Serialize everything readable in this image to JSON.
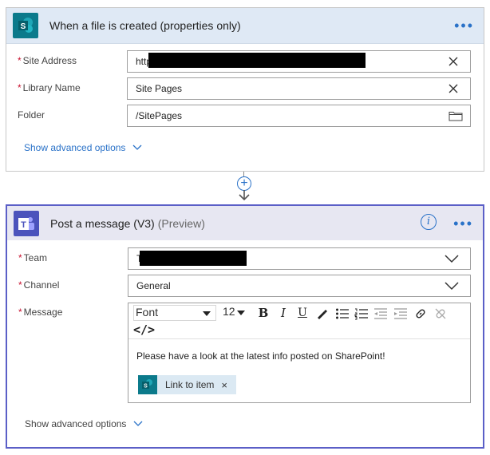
{
  "trigger": {
    "title": "When a file is created (properties only)",
    "more_label": "•••",
    "fields": {
      "site_address": {
        "label": "Site Address",
        "required": "*",
        "value": "http"
      },
      "library_name": {
        "label": "Library Name",
        "required": "*",
        "value": "Site Pages"
      },
      "folder": {
        "label": "Folder",
        "value": "/SitePages"
      }
    },
    "advanced_label": "Show advanced options",
    "app_icon": "sharepoint-icon",
    "app_icon_letter": "S"
  },
  "connector": {
    "add_label": "+"
  },
  "action": {
    "title": "Post a message (V3)",
    "badge": "(Preview)",
    "info_label": "i",
    "more_label": "•••",
    "app_icon": "teams-icon",
    "app_icon_letter": "T",
    "fields": {
      "team": {
        "label": "Team",
        "required": "*",
        "value": "T"
      },
      "channel": {
        "label": "Channel",
        "required": "*",
        "value": "General"
      },
      "message": {
        "label": "Message",
        "required": "*"
      }
    },
    "editor": {
      "font_name": "Font",
      "font_size": "12",
      "bold": "B",
      "italic": "I",
      "underline": "U",
      "code_view": "</>",
      "text": "Please have a look at the latest info posted on SharePoint!",
      "token_label": "Link to item",
      "token_remove": "×"
    },
    "advanced_label": "Show advanced options"
  },
  "colors": {
    "accent_blue": "#2a72c8",
    "sharepoint": "#0b7a8b",
    "teams": "#4b53bc",
    "required": "#c8102e"
  }
}
